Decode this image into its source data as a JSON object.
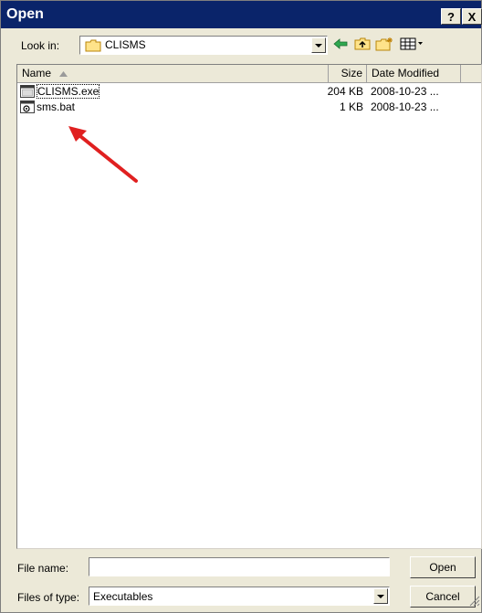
{
  "window": {
    "title": "Open",
    "help_label": "?",
    "close_label": "X"
  },
  "lookin": {
    "label": "Look in:",
    "value": "CLISMS"
  },
  "toolbar": {
    "back_icon": "back-arrow-icon",
    "up_icon": "up-folder-icon",
    "new_folder_icon": "new-folder-icon",
    "views_icon": "views-menu-icon"
  },
  "list": {
    "columns": {
      "name": "Name",
      "size": "Size",
      "date": "Date Modified"
    },
    "rows": [
      {
        "name": "CLISMS.exe",
        "size": "204 KB",
        "date": "2008-10-23 ...",
        "icon": "exe-icon"
      },
      {
        "name": "sms.bat",
        "size": "1 KB",
        "date": "2008-10-23 ...",
        "icon": "bat-icon"
      }
    ]
  },
  "annotation": {
    "arrow_color": "#e02020"
  },
  "filename": {
    "label": "File name:",
    "value": ""
  },
  "filetype": {
    "label": "Files of type:",
    "value": "Executables"
  },
  "buttons": {
    "open": "Open",
    "cancel": "Cancel"
  }
}
